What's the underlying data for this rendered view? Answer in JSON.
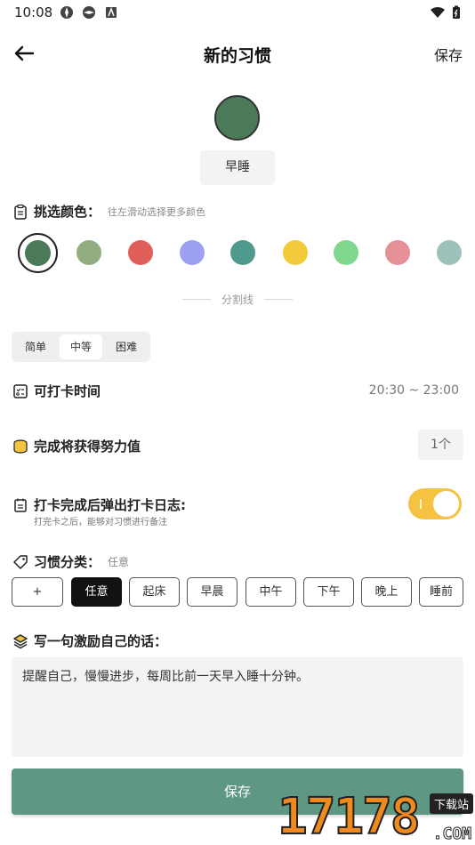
{
  "status_bar": {
    "time": "10:08"
  },
  "header": {
    "title": "新的习惯",
    "save_label": "保存"
  },
  "habit": {
    "name": "早睡",
    "color": "#4a7a57"
  },
  "color_picker": {
    "title": "挑选颜色：",
    "hint": "往左滑动选择更多颜色",
    "selected_index": 0,
    "colors": [
      "#4a7a57",
      "#91ad80",
      "#e05e58",
      "#9ea1f2",
      "#4f9a8e",
      "#f2ca3a",
      "#7fd88d",
      "#e58f97",
      "#9ec1bb"
    ]
  },
  "divider": {
    "label": "分割线"
  },
  "difficulty": {
    "options": [
      "简单",
      "中等",
      "困难"
    ],
    "selected": "中等"
  },
  "checkin_time": {
    "label": "可打卡时间",
    "value": "20:30 ~ 23:00"
  },
  "reward": {
    "label": "完成将获得努力值",
    "value": "1个"
  },
  "log_popup": {
    "label": "打卡完成后弹出打卡日志:",
    "hint": "打完卡之后，能够对习惯进行备注",
    "enabled": true
  },
  "category": {
    "label": "习惯分类：",
    "current": "任意",
    "chips": [
      "+",
      "任意",
      "起床",
      "早晨",
      "中午",
      "下午",
      "晚上",
      "睡前"
    ],
    "selected": "任意"
  },
  "motto": {
    "label": "写一句激励自己的话：",
    "text": "提醒自己，慢慢进步，每周比前一天早入睡十分钟。"
  },
  "footer": {
    "save_label": "保存",
    "accent": "#5f9882"
  },
  "watermark": {
    "digits": "17178",
    "tag": "下载站",
    "suffix": ".COM"
  }
}
